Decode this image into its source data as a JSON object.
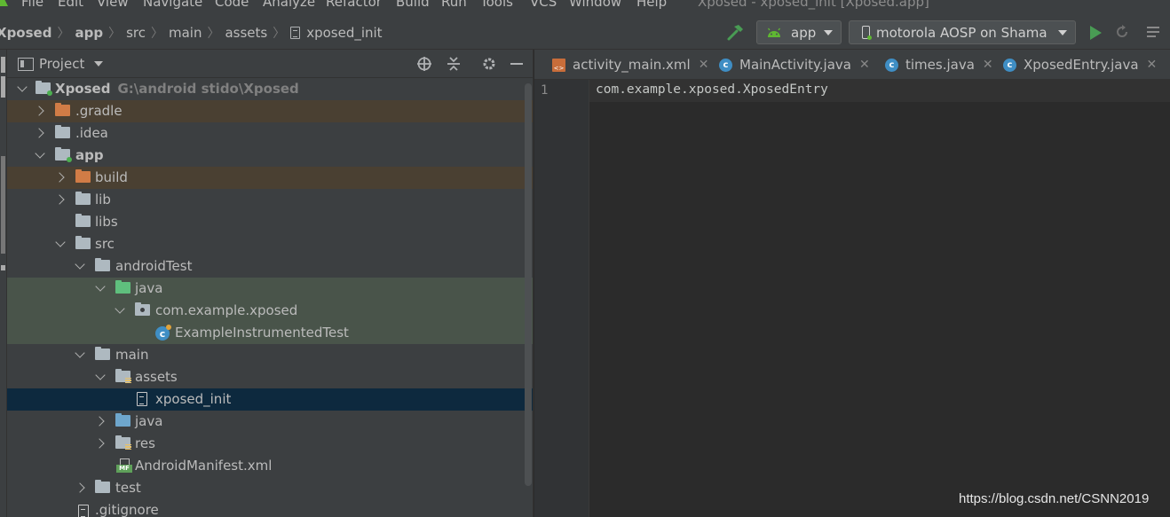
{
  "menubar": {
    "items": [
      "File",
      "Edit",
      "View",
      "Navigate",
      "Code",
      "Analyze",
      "Refactor",
      "Build",
      "Run",
      "Tools",
      "VCS",
      "Window",
      "Help"
    ],
    "window_title": "Xposed - xposed_init [Xposed.app]"
  },
  "navbar": {
    "breadcrumbs": [
      "Xposed",
      "app",
      "src",
      "main",
      "assets",
      "xposed_init"
    ],
    "run_config": "app",
    "device": "motorola AOSP on Shama"
  },
  "project_panel": {
    "title": "Project",
    "tree": [
      {
        "label": "Xposed",
        "hint": "G:\\android stido\\Xposed"
      },
      {
        "label": ".gradle"
      },
      {
        "label": ".idea"
      },
      {
        "label": "app"
      },
      {
        "label": "build"
      },
      {
        "label": "lib"
      },
      {
        "label": "libs"
      },
      {
        "label": "src"
      },
      {
        "label": "androidTest"
      },
      {
        "label": "java"
      },
      {
        "label": "com.example.xposed"
      },
      {
        "label": "ExampleInstrumentedTest"
      },
      {
        "label": "main"
      },
      {
        "label": "assets"
      },
      {
        "label": "xposed_init"
      },
      {
        "label": "java"
      },
      {
        "label": "res"
      },
      {
        "label": "AndroidManifest.xml"
      },
      {
        "label": "test"
      },
      {
        "label": ".gitignore"
      }
    ]
  },
  "editor": {
    "tabs": [
      "activity_main.xml",
      "MainActivity.java",
      "times.java",
      "XposedEntry.java"
    ],
    "lines": [
      {
        "number": "1",
        "text": "com.example.xposed.XposedEntry"
      }
    ]
  },
  "watermark": "https://blog.csdn.net/CSNN2019",
  "colors": {
    "background": "#2b2b2b",
    "panel": "#3c3f41",
    "selection": "#0d293e",
    "run_green": "#499c54",
    "class_blue": "#3f8ec4"
  },
  "icons": [
    "android-studio-logo-icon",
    "hammer-icon",
    "android-icon",
    "phone-icon",
    "run-icon",
    "rerun-icon",
    "locate-icon",
    "collapse-icon",
    "gear-icon",
    "hide-icon",
    "folder-icon",
    "class-icon",
    "file-icon",
    "manifest-icon"
  ]
}
